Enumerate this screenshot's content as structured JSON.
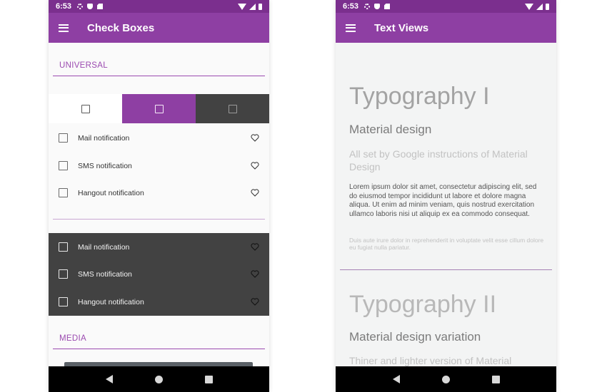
{
  "left_screen": {
    "status": {
      "time": "6:53"
    },
    "appbar": {
      "title": "Check Boxes"
    },
    "sections": {
      "universal": "UNIVERSAL",
      "media": "MEDIA"
    },
    "light_rows": [
      {
        "label": "Mail notification"
      },
      {
        "label": "SMS notification"
      },
      {
        "label": "Hangout notification"
      }
    ],
    "dark_rows": [
      {
        "label": "Mail notification"
      },
      {
        "label": "SMS notification"
      },
      {
        "label": "Hangout notification"
      }
    ],
    "strip_colors": [
      "#ffffff",
      "#8e3fa3",
      "#424242"
    ]
  },
  "right_screen": {
    "status": {
      "time": "6:53"
    },
    "appbar": {
      "title": "Text Views"
    },
    "typography_1": {
      "heading": "Typography I",
      "subheading": "Material design",
      "caption": "All set by Google instructions of Material Design",
      "body": "Lorem ipsum dolor sit amet, consectetur adipiscing elit, sed do eiusmod tempor incididunt ut labore et dolore magna aliqua. Ut enim ad minim veniam, quis nostrud exercitation ullamco laboris nisi ut aliquip ex ea commodo consequat.",
      "small": "Duis aute irure dolor in reprehenderit in voluptate velit esse cillum dolore eu fugiat nulla pariatur."
    },
    "typography_2": {
      "heading": "Typography II",
      "subheading": "Material design variation",
      "caption": "Thiner and lighter version of Material"
    }
  },
  "colors": {
    "status_bar": "#7b2f8e",
    "app_bar": "#8e3fa3",
    "accent": "#9b4ab0",
    "dark_surface": "#424242"
  }
}
